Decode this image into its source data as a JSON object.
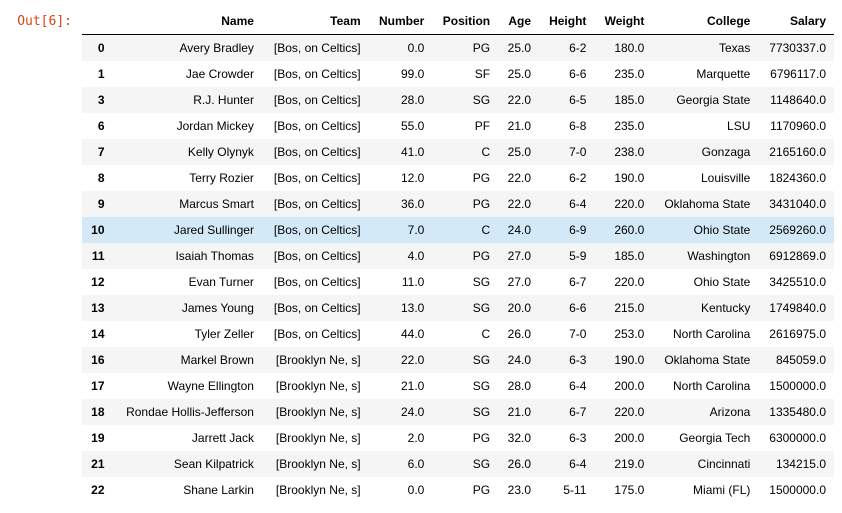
{
  "prompt": "Out[6]:",
  "columns": [
    "Name",
    "Team",
    "Number",
    "Position",
    "Age",
    "Height",
    "Weight",
    "College",
    "Salary"
  ],
  "index_name": "",
  "highlight_row": 7,
  "rows": [
    {
      "idx": "0",
      "Name": "Avery Bradley",
      "Team": "[Bos, on Celtics]",
      "Number": "0.0",
      "Position": "PG",
      "Age": "25.0",
      "Height": "6-2",
      "Weight": "180.0",
      "College": "Texas",
      "Salary": "7730337.0"
    },
    {
      "idx": "1",
      "Name": "Jae Crowder",
      "Team": "[Bos, on Celtics]",
      "Number": "99.0",
      "Position": "SF",
      "Age": "25.0",
      "Height": "6-6",
      "Weight": "235.0",
      "College": "Marquette",
      "Salary": "6796117.0"
    },
    {
      "idx": "3",
      "Name": "R.J. Hunter",
      "Team": "[Bos, on Celtics]",
      "Number": "28.0",
      "Position": "SG",
      "Age": "22.0",
      "Height": "6-5",
      "Weight": "185.0",
      "College": "Georgia State",
      "Salary": "1148640.0"
    },
    {
      "idx": "6",
      "Name": "Jordan Mickey",
      "Team": "[Bos, on Celtics]",
      "Number": "55.0",
      "Position": "PF",
      "Age": "21.0",
      "Height": "6-8",
      "Weight": "235.0",
      "College": "LSU",
      "Salary": "1170960.0"
    },
    {
      "idx": "7",
      "Name": "Kelly Olynyk",
      "Team": "[Bos, on Celtics]",
      "Number": "41.0",
      "Position": "C",
      "Age": "25.0",
      "Height": "7-0",
      "Weight": "238.0",
      "College": "Gonzaga",
      "Salary": "2165160.0"
    },
    {
      "idx": "8",
      "Name": "Terry Rozier",
      "Team": "[Bos, on Celtics]",
      "Number": "12.0",
      "Position": "PG",
      "Age": "22.0",
      "Height": "6-2",
      "Weight": "190.0",
      "College": "Louisville",
      "Salary": "1824360.0"
    },
    {
      "idx": "9",
      "Name": "Marcus Smart",
      "Team": "[Bos, on Celtics]",
      "Number": "36.0",
      "Position": "PG",
      "Age": "22.0",
      "Height": "6-4",
      "Weight": "220.0",
      "College": "Oklahoma State",
      "Salary": "3431040.0"
    },
    {
      "idx": "10",
      "Name": "Jared Sullinger",
      "Team": "[Bos, on Celtics]",
      "Number": "7.0",
      "Position": "C",
      "Age": "24.0",
      "Height": "6-9",
      "Weight": "260.0",
      "College": "Ohio State",
      "Salary": "2569260.0"
    },
    {
      "idx": "11",
      "Name": "Isaiah Thomas",
      "Team": "[Bos, on Celtics]",
      "Number": "4.0",
      "Position": "PG",
      "Age": "27.0",
      "Height": "5-9",
      "Weight": "185.0",
      "College": "Washington",
      "Salary": "6912869.0"
    },
    {
      "idx": "12",
      "Name": "Evan Turner",
      "Team": "[Bos, on Celtics]",
      "Number": "11.0",
      "Position": "SG",
      "Age": "27.0",
      "Height": "6-7",
      "Weight": "220.0",
      "College": "Ohio State",
      "Salary": "3425510.0"
    },
    {
      "idx": "13",
      "Name": "James Young",
      "Team": "[Bos, on Celtics]",
      "Number": "13.0",
      "Position": "SG",
      "Age": "20.0",
      "Height": "6-6",
      "Weight": "215.0",
      "College": "Kentucky",
      "Salary": "1749840.0"
    },
    {
      "idx": "14",
      "Name": "Tyler Zeller",
      "Team": "[Bos, on Celtics]",
      "Number": "44.0",
      "Position": "C",
      "Age": "26.0",
      "Height": "7-0",
      "Weight": "253.0",
      "College": "North Carolina",
      "Salary": "2616975.0"
    },
    {
      "idx": "16",
      "Name": "Markel Brown",
      "Team": "[Brooklyn Ne, s]",
      "Number": "22.0",
      "Position": "SG",
      "Age": "24.0",
      "Height": "6-3",
      "Weight": "190.0",
      "College": "Oklahoma State",
      "Salary": "845059.0"
    },
    {
      "idx": "17",
      "Name": "Wayne Ellington",
      "Team": "[Brooklyn Ne, s]",
      "Number": "21.0",
      "Position": "SG",
      "Age": "28.0",
      "Height": "6-4",
      "Weight": "200.0",
      "College": "North Carolina",
      "Salary": "1500000.0"
    },
    {
      "idx": "18",
      "Name": "Rondae Hollis-Jefferson",
      "Team": "[Brooklyn Ne, s]",
      "Number": "24.0",
      "Position": "SG",
      "Age": "21.0",
      "Height": "6-7",
      "Weight": "220.0",
      "College": "Arizona",
      "Salary": "1335480.0"
    },
    {
      "idx": "19",
      "Name": "Jarrett Jack",
      "Team": "[Brooklyn Ne, s]",
      "Number": "2.0",
      "Position": "PG",
      "Age": "32.0",
      "Height": "6-3",
      "Weight": "200.0",
      "College": "Georgia Tech",
      "Salary": "6300000.0"
    },
    {
      "idx": "21",
      "Name": "Sean Kilpatrick",
      "Team": "[Brooklyn Ne, s]",
      "Number": "6.0",
      "Position": "SG",
      "Age": "26.0",
      "Height": "6-4",
      "Weight": "219.0",
      "College": "Cincinnati",
      "Salary": "134215.0"
    },
    {
      "idx": "22",
      "Name": "Shane Larkin",
      "Team": "[Brooklyn Ne, s]",
      "Number": "0.0",
      "Position": "PG",
      "Age": "23.0",
      "Height": "5-11",
      "Weight": "175.0",
      "College": "Miami (FL)",
      "Salary": "1500000.0"
    }
  ]
}
